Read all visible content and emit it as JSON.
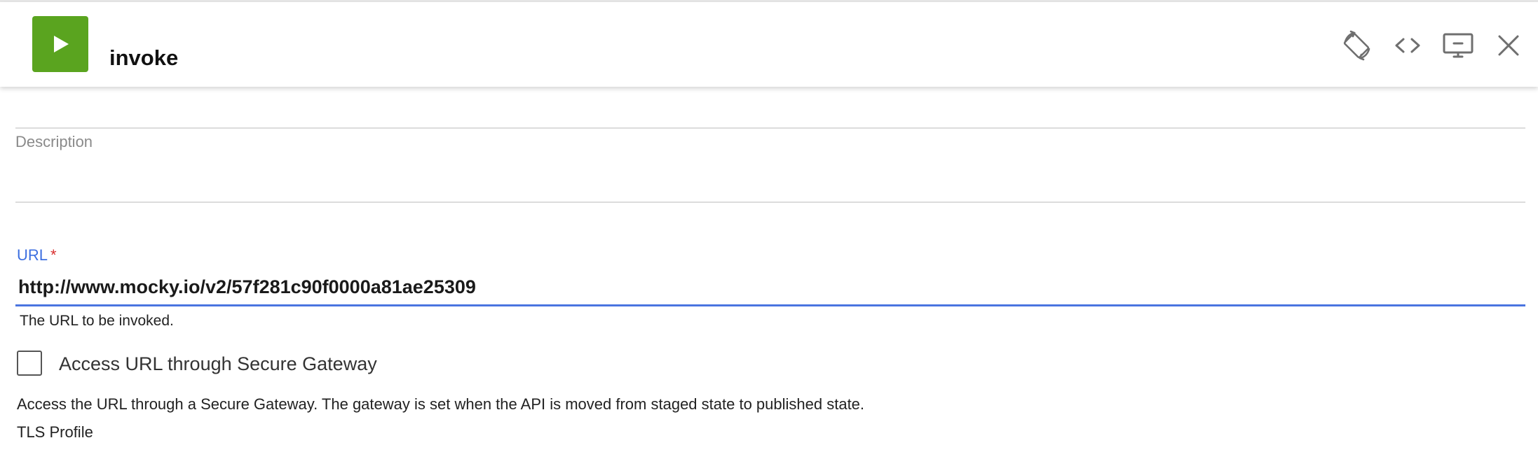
{
  "header": {
    "title": "invoke",
    "policy_icon": "play-icon",
    "icon_color": "#5aa41f",
    "actions": [
      {
        "name": "rotate-icon"
      },
      {
        "name": "code-icon"
      },
      {
        "name": "monitor-icon"
      },
      {
        "name": "close-icon"
      }
    ]
  },
  "form": {
    "description_label": "Description",
    "url": {
      "label": "URL",
      "required_marker": "*",
      "value": "http://www.mocky.io/v2/57f281c90f0000a81ae25309",
      "helper": "The URL to be invoked.",
      "accent_color": "#3d6fe0"
    },
    "secure_gateway": {
      "label": "Access URL through Secure Gateway",
      "checked": false,
      "description": "Access the URL through a Secure Gateway. The gateway is set when the API is moved from staged state to published state."
    },
    "tls_profile_label": "TLS Profile"
  }
}
